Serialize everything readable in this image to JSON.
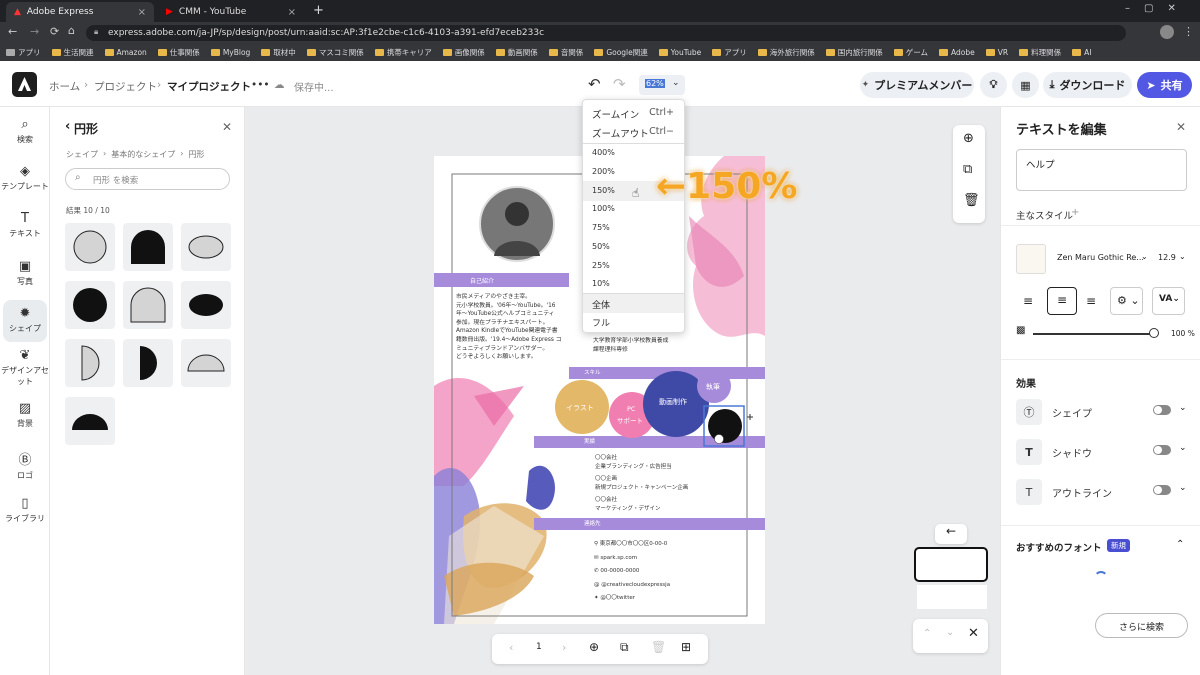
{
  "browser": {
    "tabs": [
      {
        "label": "Adobe Express",
        "close": "×"
      },
      {
        "label": "CMM - YouTube",
        "close": "×"
      }
    ],
    "new_tab": "+",
    "url": "express.adobe.com/ja-JP/sp/design/post/urn:aaid:sc:AP:3f1e2cbe-c1c6-4103-a391-efd7eceb233c",
    "bookmarks": [
      "アプリ",
      "生活関連",
      "Amazon",
      "仕事関係",
      "MyBlog",
      "取材中",
      "マスコミ関係",
      "携帯キャリア",
      "画像関係",
      "動画関係",
      "音関係",
      "Google関連",
      "YouTube",
      "アプリ",
      "海外旅行関係",
      "国内旅行関係",
      "ゲーム",
      "Adobe",
      "VR",
      "料理関係",
      "AI"
    ]
  },
  "header": {
    "breadcrumb": [
      "ホーム",
      "プロジェクト",
      "マイプロジェクト"
    ],
    "more": "•••",
    "save_status": "保存中...",
    "zoom_value": "62%",
    "premium_label": "プレミアムメンバー",
    "download_label": "ダウンロード",
    "share_label": "共有"
  },
  "rail": [
    "検索",
    "テンプレート",
    "テキスト",
    "写真",
    "シェイプ",
    "デザインアセット",
    "背景",
    "ロゴ",
    "ライブラリ"
  ],
  "panel": {
    "title": "円形",
    "path": [
      "シェイプ",
      "基本的なシェイプ",
      "円形"
    ],
    "search_placeholder": "円形 を検索",
    "result_count": "結果 10 / 10"
  },
  "zoom_menu": {
    "zoom_in": "ズームイン",
    "zoom_in_shortcut": "Ctrl+",
    "zoom_out": "ズームアウト",
    "zoom_out_shortcut": "Ctrl−",
    "levels": [
      "400%",
      "200%",
      "150%",
      "100%",
      "75%",
      "50%",
      "25%",
      "10%"
    ],
    "fit_all": "全体",
    "full": "フル"
  },
  "annotation": "←150%",
  "design": {
    "sec_intro": "自己紹介",
    "intro_lines": [
      "市民メディアのやざき主宰。",
      "元小学校教員。'06年〜YouTube。'16",
      "年〜YouTube公式ヘルプコミュニティ",
      "参加。現在プラチナエキスパート。",
      "Amazon KindleでYouTube関連電子書",
      "籍数冊出版。'19.4〜Adobe Express コ",
      "ミュニティブランドアンバサダー。",
      "どうぞよろしくお願いします。"
    ],
    "edu_lines": [
      "大学教育学部小学校教員養成",
      "課程理科専修"
    ],
    "sec_skill": "スキル",
    "skills": [
      "イラスト",
      "PC",
      "サポート",
      "動画制作",
      "執筆"
    ],
    "sec_works": "実績",
    "works": [
      "〇〇会社",
      "企業ブランディング・広告担当",
      "〇〇企画",
      "新規プロジェクト・キャンペーン企画",
      "〇〇会社",
      "マーケティング・デザイン"
    ],
    "sec_contact": "連絡先",
    "contacts": [
      "東京都〇〇市〇〇区0-00-0",
      "spark.sp.com",
      "00-0000-0000",
      "@creativecloudexpressja",
      "@〇〇twitter"
    ]
  },
  "page_nav": {
    "page_number": "1"
  },
  "right_panel": {
    "title": "テキストを編集",
    "text_value": "ヘルプ",
    "styles_label": "主なスタイル",
    "font_name": "Zen Maru Gothic Re...",
    "font_size": "12.9",
    "opacity": "100 %",
    "effects_label": "効果",
    "effects": [
      "シェイプ",
      "シャドウ",
      "アウトライン"
    ],
    "recommended_label": "おすすめのフォント",
    "new_badge": "新規",
    "search_more": "さらに検索"
  },
  "colors": {
    "accent": "#5258e4",
    "purple": "#a78bdb",
    "orange": "#f5a623"
  }
}
